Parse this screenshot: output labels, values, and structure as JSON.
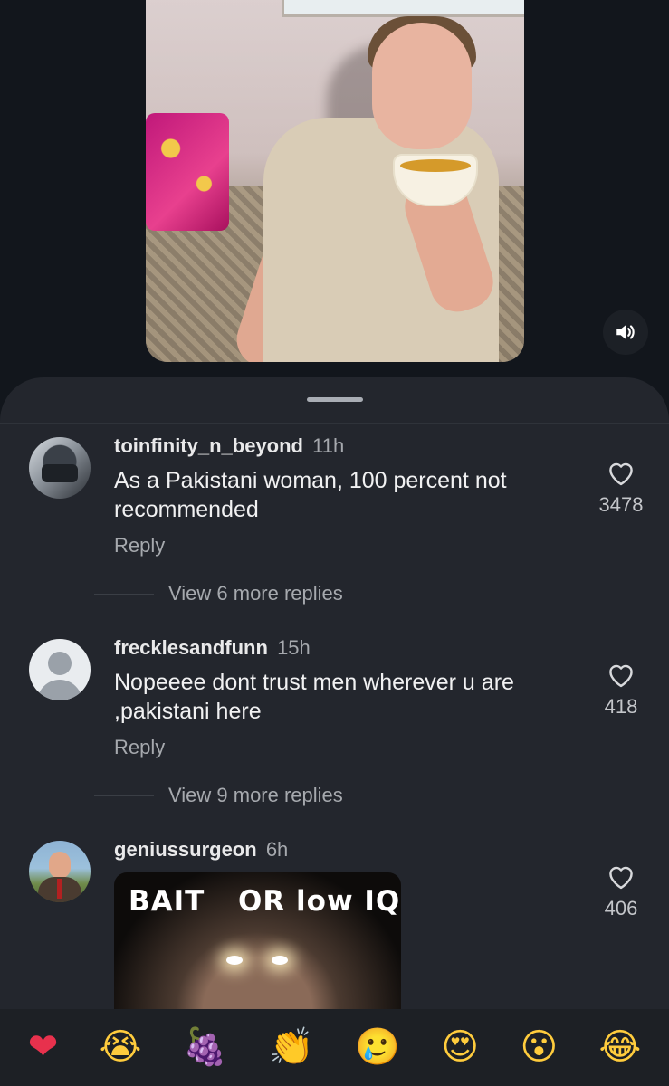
{
  "video": {
    "sound_icon": "speaker-icon"
  },
  "comments": [
    {
      "username": "toinfinity_n_beyond",
      "time": "11h",
      "text": "As a Pakistani woman, 100 percent not recommended",
      "reply_label": "Reply",
      "likes": "3478",
      "view_more": "View 6 more replies"
    },
    {
      "username": "frecklesandfunn",
      "time": "15h",
      "text": "Nopeeee dont trust men wherever u are ,pakistani here",
      "reply_label": "Reply",
      "likes": "418",
      "view_more": "View 9 more replies"
    },
    {
      "username": "geniussurgeon",
      "time": "6h",
      "image_caption_left": "BAIT",
      "image_caption_right": "OR low IQ",
      "likes": "406"
    }
  ],
  "emoji_bar": [
    "❤",
    "😭",
    "🍇",
    "👏",
    "🥲",
    "😍",
    "😮",
    "😂"
  ],
  "colors": {
    "background": "#12161c",
    "sheet": "#23262d",
    "muted_text": "#a6a9ae"
  }
}
